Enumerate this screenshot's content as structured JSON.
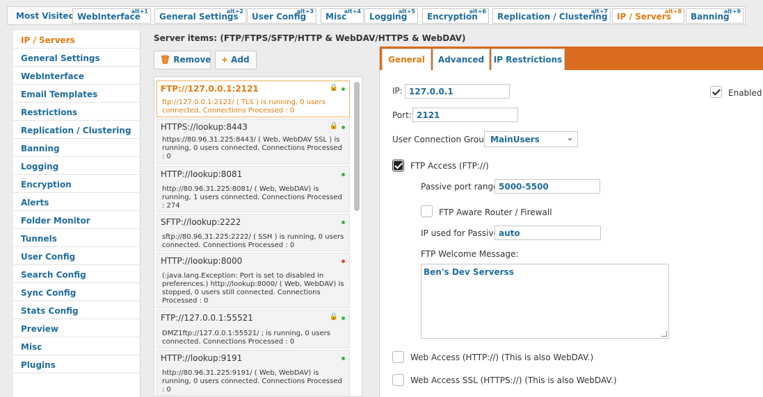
{
  "topbar": {
    "label": "Most Visited :",
    "tabs": [
      {
        "label": "WebInterface",
        "alt": "alt+1"
      },
      {
        "label": "General Settings",
        "alt": "alt+2"
      },
      {
        "label": "User Config",
        "alt": "alt+3"
      },
      {
        "label": "Misc",
        "alt": "alt+4"
      },
      {
        "label": "Logging",
        "alt": "alt+5"
      },
      {
        "label": "Encryption",
        "alt": "alt+6"
      },
      {
        "label": "Replication / Clustering",
        "alt": "alt+7"
      },
      {
        "label": "IP / Servers",
        "alt": "alt+8"
      },
      {
        "label": "Banning",
        "alt": "alt+9"
      }
    ]
  },
  "sidebar": {
    "items": [
      {
        "label": "IP / Servers"
      },
      {
        "label": "General Settings"
      },
      {
        "label": "WebInterface"
      },
      {
        "label": "Email Templates"
      },
      {
        "label": "Restrictions"
      },
      {
        "label": "Replication / Clustering"
      },
      {
        "label": "Banning"
      },
      {
        "label": "Logging"
      },
      {
        "label": "Encryption"
      },
      {
        "label": "Alerts"
      },
      {
        "label": "Folder Monitor"
      },
      {
        "label": "Tunnels"
      },
      {
        "label": "User Config"
      },
      {
        "label": "Search Config"
      },
      {
        "label": "Sync Config"
      },
      {
        "label": "Stats Config"
      },
      {
        "label": "Preview"
      },
      {
        "label": "Misc"
      },
      {
        "label": "Plugins"
      }
    ]
  },
  "servers": {
    "title": "Server items: (FTP/FTPS/SFTP/HTTP & WebDAV/HTTPS & WebDAV)",
    "remove_label": "Remove",
    "add_label": "Add",
    "items": [
      {
        "name": "FTP://127.0.0.1:2121",
        "status": "ftp://127.0.0.1:2121/ ( TLS ) is running, 0 users connected. Connections Processed : 0"
      },
      {
        "name": "HTTPS://lookup:8443",
        "status": "https://80.96.31.225:8443/ ( Web, WebDAV SSL ) is running, 0 users connected. Connections Processed : 0"
      },
      {
        "name": "HTTP://lookup:8081",
        "status": "http://80.96.31.225:8081/ ( Web, WebDAV) is running, 1 users connected. Connections Processed : 274"
      },
      {
        "name": "SFTP://lookup:2222",
        "status": "sftp://80.96.31.225:2222/ ( SSH ) is running, 0 users connected. Connections Processed : 0"
      },
      {
        "name": "HTTP://lookup:8000",
        "status": "(:java.lang.Exception: Port is set to disabled in preferences.) http://lookup:8000/ ( Web, WebDAV) is stopped, 0 users still connected. Connections Processed : 0"
      },
      {
        "name": "FTP://127.0.0.1:55521",
        "status": "DMZ1ftp://127.0.0.1:55521/ ; is running, 0 users connected. Connections Processed : 0"
      },
      {
        "name": "HTTP://lookup:9191",
        "status": "http://80.96.31.225:9191/ ( Web, WebDAV) is running, 0 users connected. Connections Processed : 0"
      }
    ]
  },
  "detail": {
    "tabs": [
      {
        "label": "General"
      },
      {
        "label": "Advanced"
      },
      {
        "label": "IP Restrictions"
      }
    ],
    "ip_label": "IP:",
    "ip_value": "127.0.0.1",
    "enabled_label": "Enabled",
    "port_label": "Port:",
    "port_value": "2121",
    "group_label": "User Connection Group:",
    "group_value": "MainUsers",
    "ftp_access_label": "FTP Access (FTP://)",
    "passive_range_label": "Passive port range:",
    "passive_range_value": "5000-5500",
    "ftp_aware_label": "FTP Aware Router / Firewall",
    "passive_ip_label": "IP used for Passive:",
    "passive_ip_value": "auto",
    "welcome_label": "FTP Welcome Message:",
    "welcome_value": "Ben's Dev Serverss",
    "web_access_label": "Web Access (HTTP://) (This is also WebDAV.)",
    "web_ssl_label": "Web Access SSL (HTTPS://) (This is also WebDAV.)"
  },
  "colors": {
    "link_blue": "#1f6c9e",
    "accent_orange": "#e07b10",
    "tabbar_orange": "#d96c1f",
    "status_ok": "#3eb33e",
    "status_err": "#e0483c"
  }
}
